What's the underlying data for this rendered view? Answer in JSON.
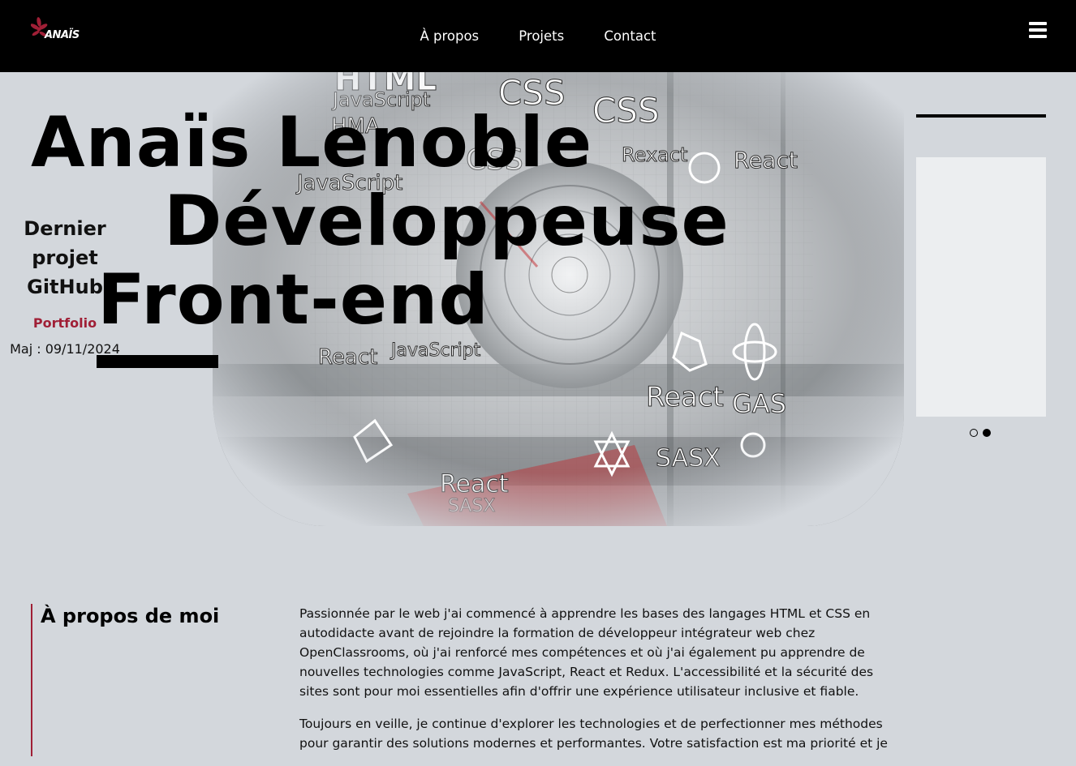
{
  "header": {
    "logo_text": "ANAÏS",
    "nav": [
      {
        "label": "À propos"
      },
      {
        "label": "Projets"
      },
      {
        "label": "Contact"
      }
    ]
  },
  "hero": {
    "title_lines": [
      "Anaïs Lenoble",
      "Développeuse",
      "Front-end"
    ],
    "image_keywords": [
      "HTML",
      "JavaScript",
      "HMA",
      "CSS",
      "CSS",
      "CSS",
      "Rexact",
      "React",
      "JavaScript",
      "React",
      "JavaScript",
      "React",
      "GAS",
      "SASX",
      "React",
      "SASX"
    ]
  },
  "card": {
    "title_lines": [
      "Dernier",
      "projet",
      "GitHub"
    ],
    "link_label": "Portfolio",
    "date": "Maj : 09/11/2024",
    "active_slide": 2,
    "slide_count": 2
  },
  "about": {
    "heading": "À propos de moi",
    "paragraphs": [
      "Passionnée par le web j'ai commencé à apprendre les bases des langages HTML et CSS en autodidacte avant de rejoindre la formation de développeur intégrateur web chez OpenClassrooms, où j'ai renforcé mes compétences et où j'ai également pu apprendre de nouvelles technologies comme JavaScript, React et Redux. L'accessibilité et la sécurité des sites sont pour moi essentielles afin d'offrir une expérience utilisateur inclusive et fiable.",
      "Toujours en veille, je continue d'explorer les technologies et de perfectionner mes méthodes pour garantir des solutions modernes et performantes. Votre satisfaction est ma priorité et je"
    ]
  },
  "colors": {
    "background": "#d3d7dc",
    "header": "#000000",
    "accent": "#a01f36",
    "card": "#eceef0"
  },
  "icons": [
    "flower-logo-icon",
    "hamburger-menu-icon"
  ]
}
